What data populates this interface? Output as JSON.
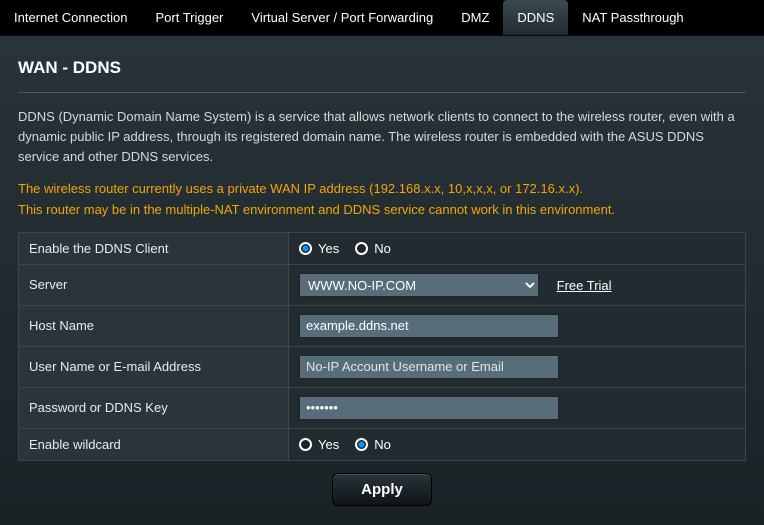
{
  "tabs": {
    "internet_connection": "Internet Connection",
    "port_trigger": "Port Trigger",
    "virtual_server": "Virtual Server / Port Forwarding",
    "dmz": "DMZ",
    "ddns": "DDNS",
    "nat_passthrough": "NAT Passthrough"
  },
  "page_title": "WAN - DDNS",
  "description": "DDNS (Dynamic Domain Name System) is a service that allows network clients to connect to the wireless router, even with a dynamic public IP address, through its registered domain name. The wireless router is embedded with the ASUS DDNS service and other DDNS services.",
  "warning_line1": "The wireless router currently uses a private WAN IP address (192.168.x.x, 10,x,x,x, or 172.16.x.x).",
  "warning_line2": "This router may be in the multiple-NAT environment and DDNS service cannot work in this environment.",
  "form": {
    "enable_client": {
      "label": "Enable the DDNS Client",
      "yes": "Yes",
      "no": "No",
      "value": "yes"
    },
    "server": {
      "label": "Server",
      "selected": "WWW.NO-IP.COM",
      "free_trial": "Free Trial"
    },
    "host_name": {
      "label": "Host Name",
      "value": "example.ddns.net"
    },
    "username": {
      "label": "User Name or E-mail Address",
      "placeholder": "No-IP Account Username or Email",
      "value": ""
    },
    "password": {
      "label": "Password or DDNS Key",
      "value": "•••••••"
    },
    "wildcard": {
      "label": "Enable wildcard",
      "yes": "Yes",
      "no": "No",
      "value": "no"
    }
  },
  "apply_label": "Apply"
}
